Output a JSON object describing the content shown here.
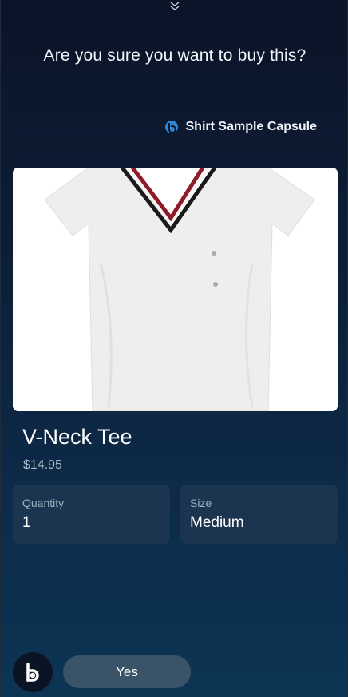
{
  "header": {
    "collapse_icon": "chevron-double-down-icon",
    "question": "Are you sure you want to buy this?"
  },
  "capsule": {
    "icon": "bixby-capsule-icon",
    "name": "Shirt Sample Capsule"
  },
  "product": {
    "image_icon": "v-neck-tee-image",
    "name": "V-Neck Tee",
    "price": "$14.95"
  },
  "fields": {
    "quantity": {
      "label": "Quantity",
      "value": "1"
    },
    "size": {
      "label": "Size",
      "value": "Medium"
    }
  },
  "footer": {
    "bixby_icon": "bixby-icon",
    "yes_label": "Yes"
  },
  "colors": {
    "background_top": "#0b1428",
    "background_bottom": "#0c3554",
    "field_bg": "#1b3550",
    "button_bg": "#3a5369",
    "accent_stripe": "#8e1b2a"
  }
}
